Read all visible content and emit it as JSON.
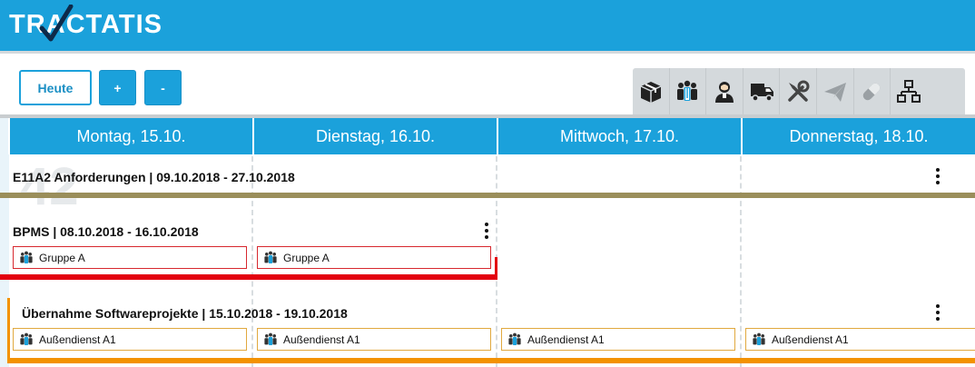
{
  "app": {
    "logo": "TRACTATIS",
    "colors": {
      "brand": "#1ba1db",
      "today_border": "#1ba1db",
      "olive_line": "#9a8e5a",
      "red_line": "#e3000f",
      "orange_line": "#f39200"
    }
  },
  "toolbar": {
    "today_label": "Heute",
    "zoom_in_label": "+",
    "zoom_out_label": "-",
    "resource_icons": [
      "box-icon",
      "group-icon",
      "person-icon",
      "truck-icon",
      "tools-icon",
      "paper-plane-icon",
      "pill-icon",
      "org-chart-icon"
    ]
  },
  "calendar": {
    "week_watermark": "42",
    "days": [
      "Montag, 15.10.",
      "Dienstag, 16.10.",
      "Mittwoch, 17.10.",
      "Donnerstag, 18.10."
    ],
    "events": [
      {
        "title": "E11A2 Anforderungen  | 09.10.2018 - 27.10.2018",
        "resources": []
      },
      {
        "title": "BPMS | 08.10.2018 - 16.10.2018",
        "resources": [
          "Gruppe A",
          "Gruppe A"
        ]
      },
      {
        "title": "Übernahme Softwareprojekte | 15.10.2018 - 19.10.2018",
        "resources": [
          "Außendienst A1",
          "Außendienst A1",
          "Außendienst A1",
          "Außendienst A1"
        ]
      }
    ]
  }
}
